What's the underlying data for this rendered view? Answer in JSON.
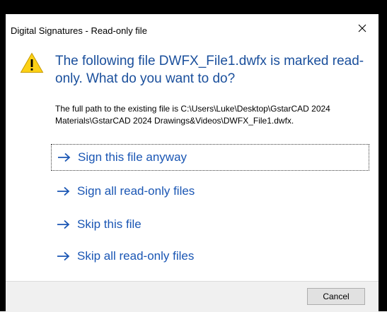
{
  "window": {
    "title": "Digital Signatures - Read-only file",
    "close_icon": "close-icon"
  },
  "dialog": {
    "icon": "warning-icon",
    "main_instruction": "The following file DWFX_File1.dwfx is marked read-only. What do you want to do?",
    "content": "The full path to the existing file is C:\\Users\\Luke\\Desktop\\GstarCAD 2024 Materials\\GstarCAD 2024 Drawings&Videos\\DWFX_File1.dwfx.",
    "options": [
      {
        "label": "Sign this file anyway"
      },
      {
        "label": "Sign all read-only files"
      },
      {
        "label": "Skip this file"
      },
      {
        "label": "Skip all read-only files"
      }
    ]
  },
  "footer": {
    "cancel_label": "Cancel"
  },
  "colors": {
    "instruction_blue": "#1a4f9c",
    "link_blue": "#1a56b4",
    "warning_yellow": "#fcd116",
    "footer_bg": "#f0f0f0"
  }
}
